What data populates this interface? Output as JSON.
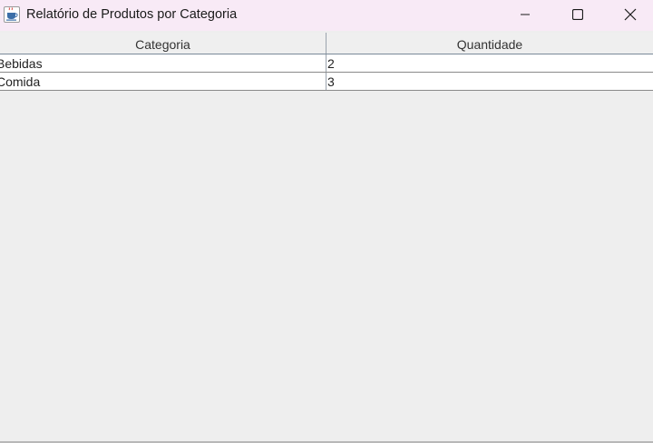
{
  "window": {
    "title": "Relatório de Produtos por Categoria"
  },
  "table": {
    "columns": [
      "Categoria",
      "Quantidade"
    ],
    "rows": [
      {
        "categoria": "Bebidas",
        "quantidade": "2"
      },
      {
        "categoria": "Comida",
        "quantidade": "3"
      }
    ]
  },
  "icons": {
    "app": "java-coffee-cup-icon",
    "minimize": "minimize-icon",
    "maximize": "maximize-icon",
    "close": "close-icon"
  },
  "colors": {
    "titlebar": "#f8eaf6",
    "window_bg": "#eeeeee",
    "row_bg": "#ffffff",
    "header_bg": "#efefef"
  }
}
